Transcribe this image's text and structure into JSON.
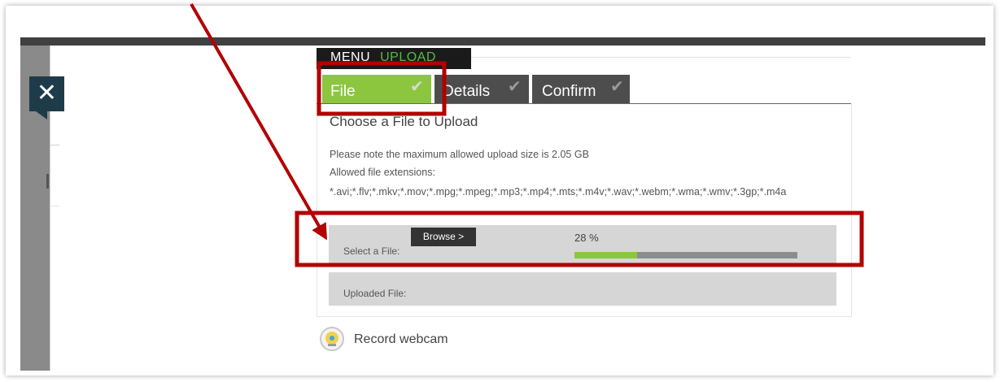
{
  "sidebar": {
    "close_glyph": "✕"
  },
  "menu_bar": {
    "menu_label": "MENU",
    "upload_label": "UPLOAD"
  },
  "tabs": [
    {
      "label": "File",
      "check": "✔",
      "state": "active"
    },
    {
      "label": "Details",
      "check": "✔",
      "state": "inactive"
    },
    {
      "label": "Confirm",
      "check": "✔",
      "state": "inactive"
    }
  ],
  "panel": {
    "title": "Choose a File to Upload",
    "size_note": "Please note the maximum allowed upload size is 2.05 GB",
    "extensions_label": "Allowed file extensions:",
    "extensions": "*.avi;*.flv;*.mkv;*.mov;*.mpg;*.mpeg;*.mp3;*.mp4;*.mts;*.m4v;*.wav;*.webm;*.wma;*.wmv;*.3gp;*.m4a"
  },
  "file_select": {
    "label": "Select a File:",
    "browse_label": "Browse >",
    "progress_text": "28 %",
    "progress_fraction": 0.28
  },
  "uploaded_file": {
    "label": "Uploaded File:"
  },
  "webcam": {
    "label": "Record webcam"
  },
  "colors": {
    "accent_green": "#8cc63f",
    "annotation_red": "#b30000",
    "tab_dark": "#4d4d4d",
    "close_bg": "#1e3b4a"
  }
}
